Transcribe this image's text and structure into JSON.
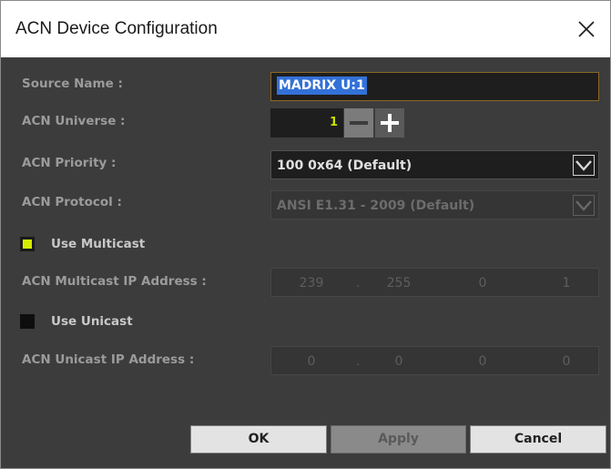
{
  "window": {
    "title": "ACN Device Configuration",
    "close_icon": "close-icon"
  },
  "labels": {
    "source_name": "Source Name :",
    "acn_universe": "ACN Universe :",
    "acn_priority": "ACN Priority :",
    "acn_protocol": "ACN Protocol :",
    "multicast_ip": "ACN Multicast IP Address :",
    "unicast_ip": "ACN Unicast IP Address :"
  },
  "source_name": {
    "value": "MADRIX U:1"
  },
  "universe": {
    "value": "1",
    "minus_icon": "minus-icon",
    "plus_icon": "plus-icon"
  },
  "priority": {
    "selected": "100 0x64 (Default)"
  },
  "protocol": {
    "selected": "ANSI E1.31 - 2009 (Default)"
  },
  "multicast": {
    "checkbox_label": "Use Multicast",
    "checked": true,
    "checked_color": "#d4ec00",
    "octets": [
      "239",
      "255",
      "0",
      "1"
    ]
  },
  "unicast": {
    "checkbox_label": "Use Unicast",
    "checked": false,
    "octets": [
      "0",
      "0",
      "0",
      "0"
    ]
  },
  "buttons": {
    "ok": "OK",
    "apply": "Apply",
    "cancel": "Cancel"
  },
  "colors": {
    "panel_bg": "#3c3c3c",
    "selection": "#3371d8",
    "universe_value": "#c7e000"
  }
}
